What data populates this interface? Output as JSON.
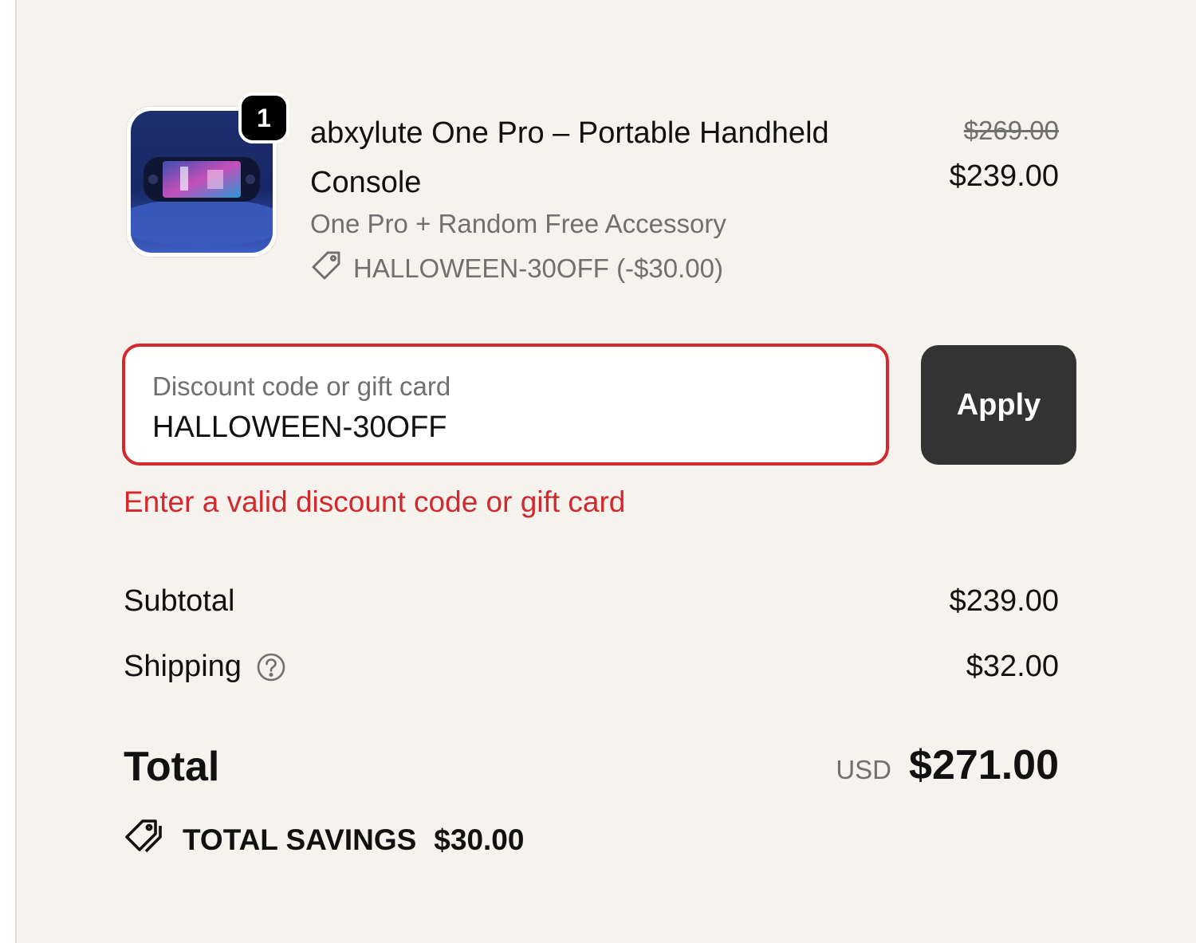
{
  "product": {
    "quantity_badge": "1",
    "title": "abxylute One Pro – Portable Handheld Console",
    "variant": "One Pro + Random Free Accessory",
    "discount_applied": "HALLOWEEN-30OFF (-$30.00)",
    "price_original": "$269.00",
    "price_current": "$239.00"
  },
  "discount": {
    "label": "Discount code or gift card",
    "value": "HALLOWEEN-30OFF",
    "apply_label": "Apply",
    "error": "Enter a valid discount code or gift card",
    "error_color": "#d3282c"
  },
  "summary": {
    "subtotal_label": "Subtotal",
    "subtotal_value": "$239.00",
    "shipping_label": "Shipping",
    "shipping_value": "$32.00",
    "total_label": "Total",
    "currency": "USD",
    "total_value": "$271.00",
    "savings_label": "TOTAL SAVINGS",
    "savings_value": "$30.00"
  },
  "icons": {
    "tag": "tag-icon",
    "help": "help-circle-icon",
    "savings": "double-tag-icon"
  }
}
